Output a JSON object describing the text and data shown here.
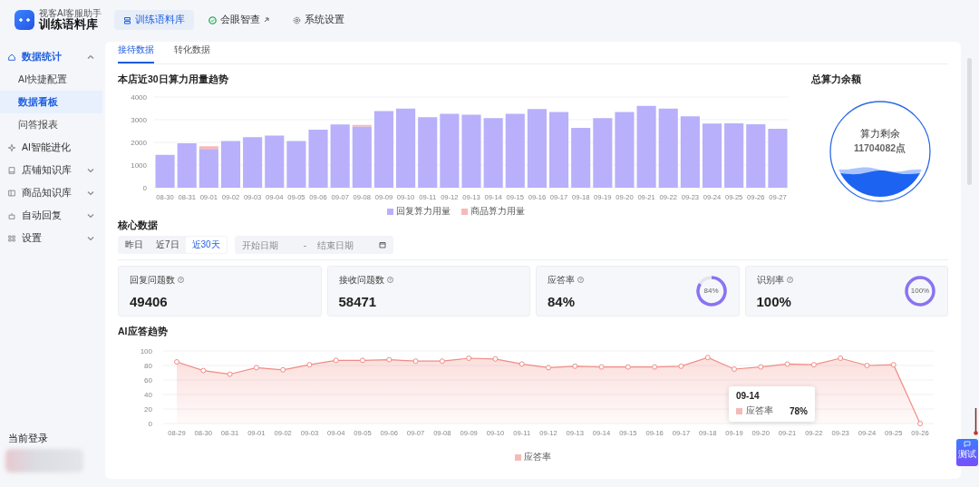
{
  "header": {
    "subtitle": "视客AI客服助手",
    "title": "训练语料库",
    "nav": [
      {
        "label": "训练语料库",
        "selected": true
      },
      {
        "label": "会眼智查",
        "selected": false,
        "external": true
      },
      {
        "label": "系统设置",
        "selected": false
      }
    ]
  },
  "sidebar": {
    "items": [
      {
        "label": "数据统计",
        "active": true,
        "expanded": true,
        "children": [
          {
            "label": "AI快捷配置",
            "selected": false
          },
          {
            "label": "数据看板",
            "selected": true
          },
          {
            "label": "问答报表",
            "selected": false
          }
        ]
      },
      {
        "label": "AI智能进化",
        "active": false
      },
      {
        "label": "店铺知识库",
        "active": false,
        "expanded": false
      },
      {
        "label": "商品知识库",
        "active": false,
        "expanded": false
      },
      {
        "label": "自动回复",
        "active": false,
        "expanded": false
      },
      {
        "label": "设置",
        "active": false,
        "expanded": false
      }
    ],
    "login_label": "当前登录"
  },
  "tabs": [
    {
      "label": "接待数据",
      "selected": true
    },
    {
      "label": "转化数据",
      "selected": false
    }
  ],
  "usage": {
    "title": "本店近30日算力用量趋势",
    "chart_data": {
      "type": "bar",
      "stacked": true,
      "grid": true,
      "categories": [
        "08-30",
        "08-31",
        "09-01",
        "09-02",
        "09-03",
        "09-04",
        "09-05",
        "09-06",
        "09-07",
        "09-08",
        "09-09",
        "09-10",
        "09-11",
        "09-12",
        "09-13",
        "09-14",
        "09-15",
        "09-16",
        "09-17",
        "09-18",
        "09-19",
        "09-20",
        "09-21",
        "09-22",
        "09-23",
        "09-24",
        "09-25",
        "09-26",
        "09-27"
      ],
      "ylim": [
        0,
        4000
      ],
      "yticks": [
        0,
        1000,
        2000,
        3000,
        4000
      ],
      "series": [
        {
          "name": "回复算力用量",
          "color": "#b8b0fb",
          "values": [
            1450,
            1960,
            1710,
            2060,
            2230,
            2300,
            2060,
            2560,
            2790,
            2700,
            3380,
            3490,
            3110,
            3260,
            3220,
            3070,
            3260,
            3470,
            3340,
            2640,
            3070,
            3340,
            3610,
            3490,
            3150,
            2830,
            2840,
            2800,
            2600
          ]
        },
        {
          "name": "商品算力用量",
          "color": "#f8b9b9",
          "values": [
            0,
            0,
            120,
            0,
            null,
            0,
            0,
            0,
            0,
            70,
            0,
            0,
            0,
            0,
            0,
            0,
            0,
            null,
            0,
            0,
            0,
            0,
            0,
            0,
            0,
            0,
            0,
            0,
            0
          ]
        }
      ]
    }
  },
  "balance": {
    "title": "总算力余额",
    "label": "算力剩余",
    "value": "11704082点"
  },
  "core": {
    "title": "核心数据",
    "ranges": [
      {
        "label": "昨日",
        "selected": false
      },
      {
        "label": "近7日",
        "selected": false
      },
      {
        "label": "近30天",
        "selected": true
      }
    ],
    "start_placeholder": "开始日期",
    "separator": "-",
    "end_placeholder": "结束日期",
    "stats": [
      {
        "label": "回复问题数",
        "value": "49406"
      },
      {
        "label": "接收问题数",
        "value": "58471"
      },
      {
        "label": "应答率",
        "value": "84%",
        "ring_label": "84%",
        "level": 0.84
      },
      {
        "label": "识别率",
        "value": "100%",
        "ring_label": "100%",
        "level": 1
      }
    ]
  },
  "trend": {
    "title": "AI应答趋势",
    "chart_data": {
      "type": "line",
      "grid": true,
      "x": [
        "08-29",
        "08-30",
        "08-31",
        "09-01",
        "09-02",
        "09-03",
        "09-04",
        "09-05",
        "09-06",
        "09-07",
        "09-08",
        "09-09",
        "09-10",
        "09-11",
        "09-12",
        "09-13",
        "09-14",
        "09-15",
        "09-16",
        "09-17",
        "09-18",
        "09-19",
        "09-20",
        "09-21",
        "09-22",
        "09-23",
        "09-24",
        "09-25",
        "09-26"
      ],
      "ylim": [
        0,
        100
      ],
      "yticks": [
        0,
        20,
        40,
        60,
        80,
        100
      ],
      "series": [
        {
          "name": "应答率",
          "color": "#f08c84",
          "marker": true,
          "values": [
            85,
            73,
            68,
            77,
            74,
            81,
            87,
            87,
            88,
            86,
            86,
            90,
            89,
            82,
            77,
            79,
            78,
            78,
            78,
            79,
            91,
            75,
            78,
            82,
            81,
            90,
            80,
            81,
            0
          ]
        }
      ]
    },
    "tooltip": {
      "title": "09-14",
      "series": "应答率",
      "value": "78%"
    }
  },
  "float_button": {
    "label": "测试"
  }
}
